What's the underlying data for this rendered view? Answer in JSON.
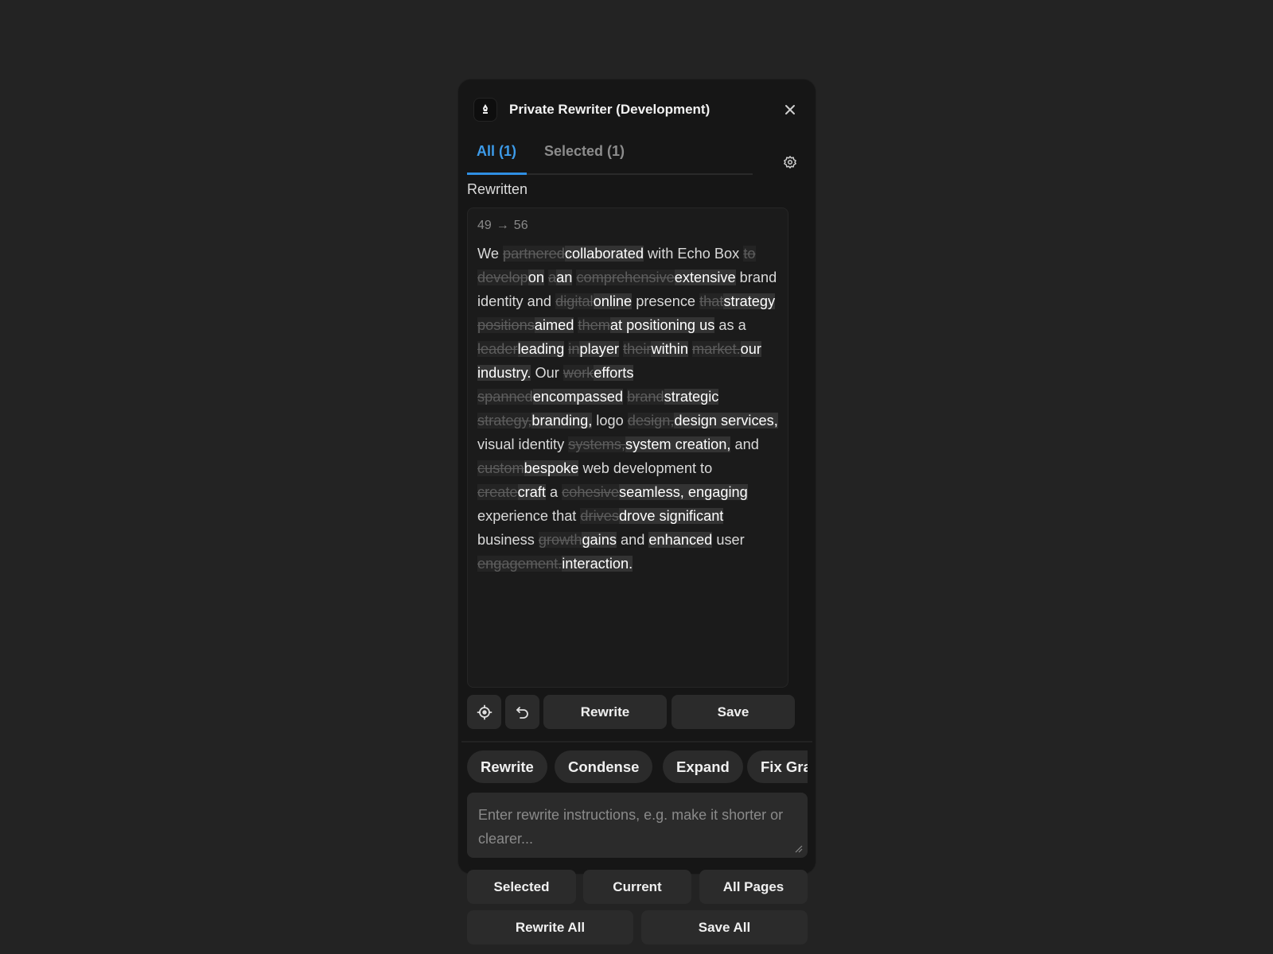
{
  "header": {
    "title": "Private Rewriter (Development)",
    "logo_icon": "pen-nib-icon",
    "close_icon": "close-icon"
  },
  "tabs": [
    {
      "label": "All (1)",
      "active": true
    },
    {
      "label": "Selected (1)",
      "active": false
    }
  ],
  "settings_icon": "gear-icon",
  "section_label": "Rewritten",
  "rewrite": {
    "count_from": "49",
    "arrow": "→",
    "count_to": "56",
    "segments": [
      {
        "t": "We ",
        "k": "same"
      },
      {
        "t": "partnered",
        "k": "del"
      },
      {
        "t": "collaborated",
        "k": "ins"
      },
      {
        "t": " with Echo Box ",
        "k": "same"
      },
      {
        "t": "to develop",
        "k": "del"
      },
      {
        "t": "on",
        "k": "ins"
      },
      {
        "t": " ",
        "k": "same"
      },
      {
        "t": "a",
        "k": "del"
      },
      {
        "t": "an",
        "k": "ins"
      },
      {
        "t": " ",
        "k": "same"
      },
      {
        "t": "comprehensive",
        "k": "del"
      },
      {
        "t": "extensive",
        "k": "ins"
      },
      {
        "t": " brand identity and ",
        "k": "same"
      },
      {
        "t": "digital",
        "k": "del"
      },
      {
        "t": "online",
        "k": "ins"
      },
      {
        "t": " presence ",
        "k": "same"
      },
      {
        "t": "that",
        "k": "del"
      },
      {
        "t": "strategy",
        "k": "ins"
      },
      {
        "t": " ",
        "k": "same"
      },
      {
        "t": "positions",
        "k": "del"
      },
      {
        "t": "aimed",
        "k": "ins"
      },
      {
        "t": " ",
        "k": "same"
      },
      {
        "t": "them",
        "k": "del"
      },
      {
        "t": "at positioning us",
        "k": "ins"
      },
      {
        "t": " as a ",
        "k": "same"
      },
      {
        "t": "leader",
        "k": "del"
      },
      {
        "t": "leading",
        "k": "ins"
      },
      {
        "t": " ",
        "k": "same"
      },
      {
        "t": "in",
        "k": "del"
      },
      {
        "t": "player",
        "k": "ins"
      },
      {
        "t": " ",
        "k": "same"
      },
      {
        "t": "their",
        "k": "del"
      },
      {
        "t": "within",
        "k": "ins"
      },
      {
        "t": " ",
        "k": "same"
      },
      {
        "t": "market.",
        "k": "del"
      },
      {
        "t": "our industry.",
        "k": "ins"
      },
      {
        "t": " Our ",
        "k": "same"
      },
      {
        "t": "work",
        "k": "del"
      },
      {
        "t": "efforts",
        "k": "ins"
      },
      {
        "t": " ",
        "k": "same"
      },
      {
        "t": "spanned",
        "k": "del"
      },
      {
        "t": "encompassed",
        "k": "ins"
      },
      {
        "t": " ",
        "k": "same"
      },
      {
        "t": "brand",
        "k": "del"
      },
      {
        "t": "strategic",
        "k": "ins"
      },
      {
        "t": " ",
        "k": "same"
      },
      {
        "t": "strategy,",
        "k": "del"
      },
      {
        "t": "branding,",
        "k": "ins"
      },
      {
        "t": " logo ",
        "k": "same"
      },
      {
        "t": "design,",
        "k": "del"
      },
      {
        "t": "design services,",
        "k": "ins"
      },
      {
        "t": " visual identity ",
        "k": "same"
      },
      {
        "t": "systems,",
        "k": "del"
      },
      {
        "t": "system creation,",
        "k": "ins"
      },
      {
        "t": " and ",
        "k": "same"
      },
      {
        "t": "custom",
        "k": "del"
      },
      {
        "t": "bespoke",
        "k": "ins"
      },
      {
        "t": " web development to ",
        "k": "same"
      },
      {
        "t": "create",
        "k": "del"
      },
      {
        "t": "craft",
        "k": "ins"
      },
      {
        "t": " a ",
        "k": "same"
      },
      {
        "t": "cohesive",
        "k": "del"
      },
      {
        "t": "seamless, engaging",
        "k": "ins"
      },
      {
        "t": " experience that ",
        "k": "same"
      },
      {
        "t": "drives",
        "k": "del"
      },
      {
        "t": "drove significant",
        "k": "ins"
      },
      {
        "t": " business ",
        "k": "same"
      },
      {
        "t": "growth",
        "k": "del"
      },
      {
        "t": "gains",
        "k": "ins"
      },
      {
        "t": " and ",
        "k": "same"
      },
      {
        "t": "enhanced",
        "k": "ins"
      },
      {
        "t": " user ",
        "k": "same"
      },
      {
        "t": "engagement.",
        "k": "del"
      },
      {
        "t": "interaction.",
        "k": "ins"
      }
    ]
  },
  "actions": {
    "locate_icon": "crosshair-icon",
    "undo_icon": "undo-icon",
    "rewrite_label": "Rewrite",
    "save_label": "Save"
  },
  "chips": [
    "Rewrite",
    "Condense",
    "Expand",
    "Fix Grammar"
  ],
  "instructions": {
    "placeholder": "Enter rewrite instructions, e.g. make it shorter or clearer..."
  },
  "scope_buttons": [
    "Selected",
    "Current",
    "All Pages"
  ],
  "bottom_buttons": {
    "rewrite_all": "Rewrite All",
    "save_all": "Save All"
  },
  "colors": {
    "accent": "#3d9be9",
    "background": "#232323",
    "panel": "#161616"
  }
}
